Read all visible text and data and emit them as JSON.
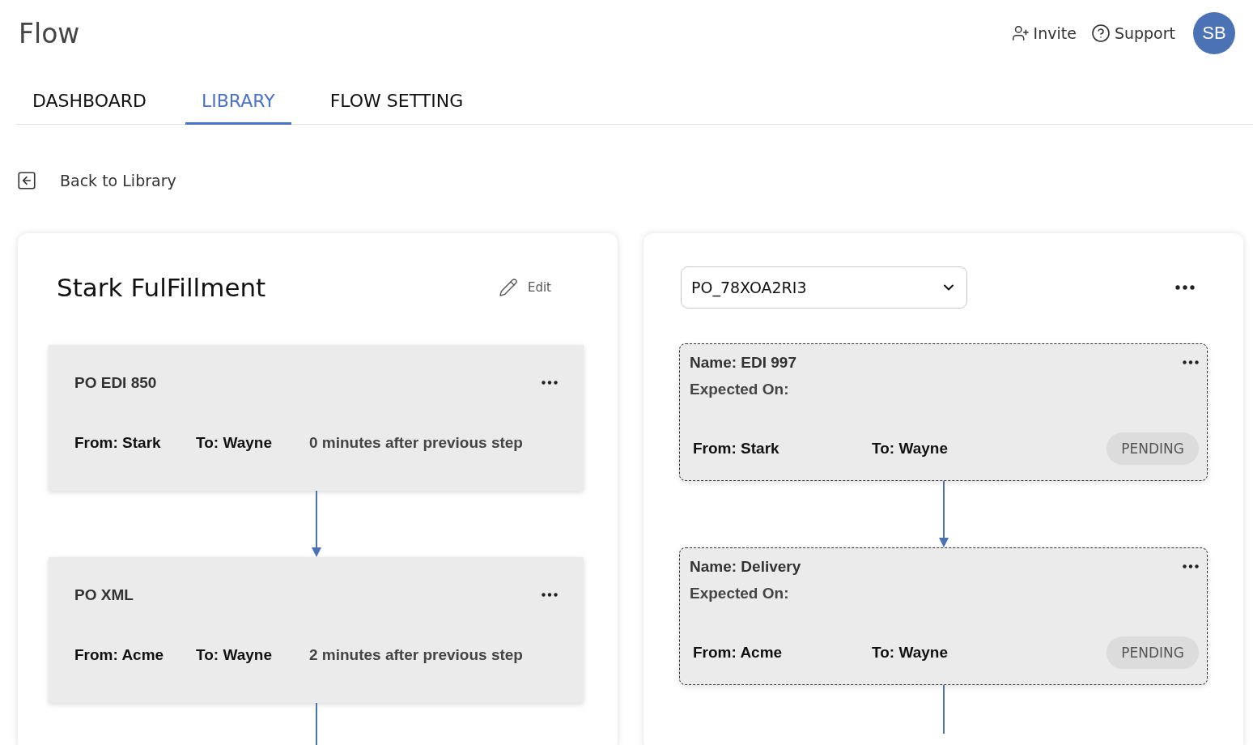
{
  "app": {
    "title": "Flow"
  },
  "header_actions": [
    {
      "kind": "invite",
      "label": "Invite"
    },
    {
      "kind": "support",
      "label": "Support"
    }
  ],
  "avatar": {
    "initials": "SB"
  },
  "tabs": [
    {
      "label": "DASHBOARD",
      "selected": false
    },
    {
      "label": "LIBRARY",
      "selected": true
    },
    {
      "label": "FLOW SETTING",
      "selected": false
    }
  ],
  "back_link": {
    "label": "Back to Library"
  },
  "flow_panel": {
    "title": "Stark FulFillment",
    "edit_label": "Edit",
    "steps": [
      {
        "name": "PO EDI 850",
        "from": "From: Stark",
        "to": "To: Wayne",
        "delay": "0 minutes after previous step"
      },
      {
        "name": "PO XML",
        "from": "From: Acme",
        "to": "To: Wayne",
        "delay": "2 minutes after previous step"
      }
    ]
  },
  "instance_panel": {
    "selected_order": "PO_78XOA2RI3",
    "steps": [
      {
        "name": "Name: EDI 997",
        "expected": "Expected On:",
        "from": "From: Stark",
        "to": "To: Wayne",
        "status": "PENDING"
      },
      {
        "name": "Name: Delivery",
        "expected": "Expected On:",
        "from": "From: Acme",
        "to": "To: Wayne",
        "status": "PENDING"
      }
    ]
  }
}
